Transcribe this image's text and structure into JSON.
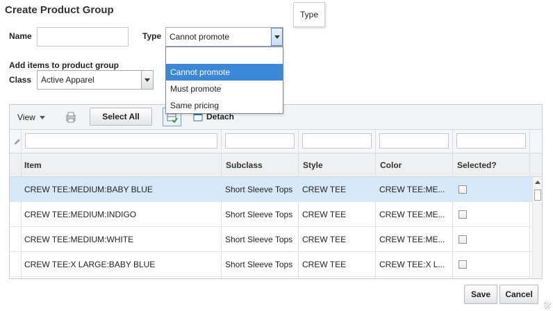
{
  "dialog": {
    "title": "Create Product Group"
  },
  "tooltip": {
    "text": "Type"
  },
  "form": {
    "name_label": "Name",
    "name_value": "",
    "type_label": "Type",
    "type_value": "Cannot promote",
    "type_options": [
      "",
      "Cannot promote",
      "Must promote",
      "Same pricing"
    ],
    "add_items_label": "Add items to product group",
    "class_label": "Class",
    "class_value": "Active Apparel"
  },
  "toolbar": {
    "view_label": "View",
    "select_all_label": "Select All",
    "detach_label": "Detach"
  },
  "table": {
    "columns": [
      "Item",
      "Subclass",
      "Style",
      "Color",
      "Selected?"
    ],
    "rows": [
      {
        "item": "CREW TEE:MEDIUM:BABY BLUE",
        "subclass": "Short Sleeve Tops",
        "style": "CREW TEE",
        "color": "CREW TEE:ME...",
        "selected": false
      },
      {
        "item": "CREW TEE:MEDIUM:INDIGO",
        "subclass": "Short Sleeve Tops",
        "style": "CREW TEE",
        "color": "CREW TEE:ME...",
        "selected": false
      },
      {
        "item": "CREW TEE:MEDIUM:WHITE",
        "subclass": "Short Sleeve Tops",
        "style": "CREW TEE",
        "color": "CREW TEE:ME...",
        "selected": false
      },
      {
        "item": "CREW TEE:X LARGE:BABY BLUE",
        "subclass": "Short Sleeve Tops",
        "style": "CREW TEE",
        "color": "CREW TEE:X L...",
        "selected": false
      }
    ]
  },
  "footer": {
    "save_label": "Save",
    "cancel_label": "Cancel"
  },
  "colors": {
    "accent": "#3a88d6",
    "selected_row": "#d6e8f9"
  }
}
